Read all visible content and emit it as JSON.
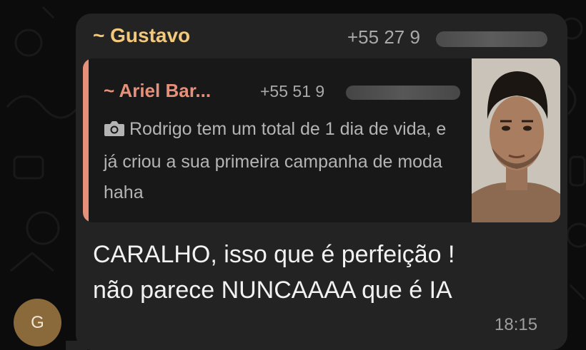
{
  "message": {
    "sender_name": "~ Gustavo",
    "sender_phone": "+55 27 9",
    "reply": {
      "author_name": "~ Ariel Bar...",
      "author_phone": "+55 51 9",
      "media_icon": "camera-icon",
      "text": "Rodrigo tem um total de 1 dia de vida, e já criou a sua primeira campanha de moda haha"
    },
    "text_line1": "CARALHO, isso que é perfeição !",
    "text_line2": "não parece NUNCAAAA que é IA",
    "time": "18:15"
  },
  "avatar": {
    "initial": "G"
  },
  "colors": {
    "sender_name": "#f2c97c",
    "reply_accent": "#e6907a",
    "bubble": "#232323",
    "background": "#0c0c0c"
  }
}
